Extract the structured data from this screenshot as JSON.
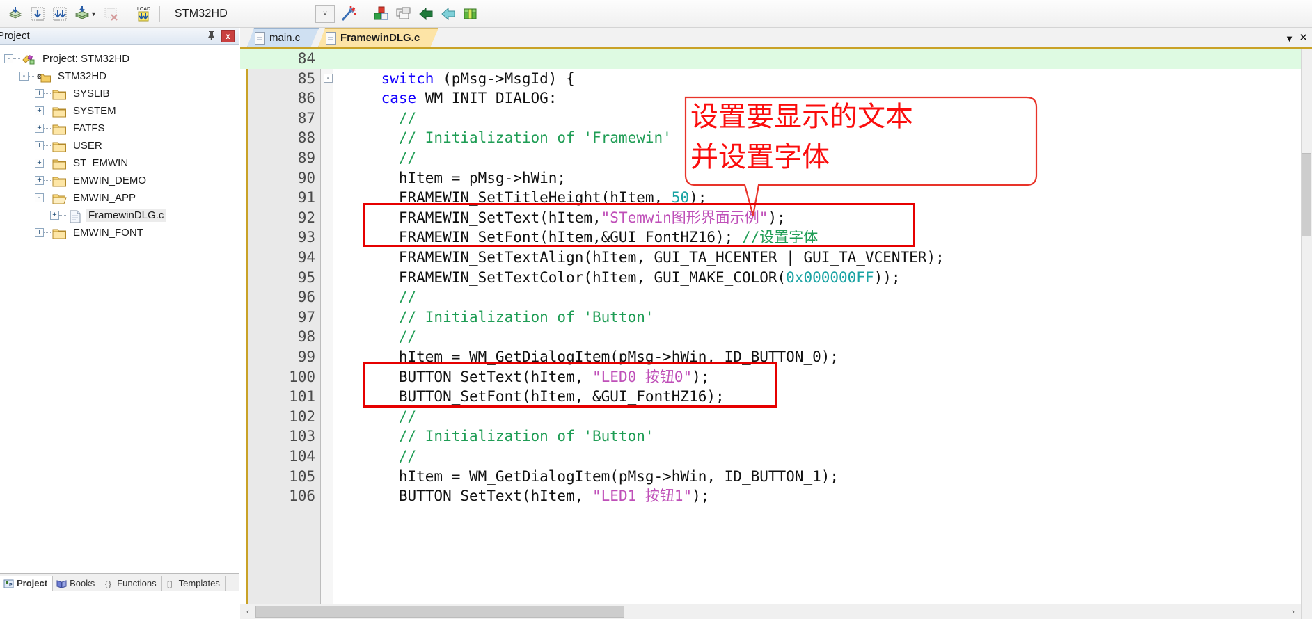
{
  "toolbar": {
    "icons": [
      {
        "name": "download-to-flash-icon"
      },
      {
        "name": "debug-start-icon"
      },
      {
        "name": "debug-stop-icon"
      },
      {
        "name": "batch-build-icon"
      },
      {
        "name": "remove-icon"
      },
      {
        "name": "load-icon"
      }
    ],
    "target_select": "STM32HD",
    "combo_caret": "∨",
    "right_icons": [
      {
        "name": "magic-wand-icon"
      },
      {
        "name": "target-options-icon"
      },
      {
        "name": "manage-windows-icon"
      },
      {
        "name": "bookmark-blue-icon"
      },
      {
        "name": "bookmark-green-icon"
      },
      {
        "name": "pack-installer-icon"
      }
    ]
  },
  "project_panel": {
    "title": "Project",
    "pin_glyph": "丨",
    "close_label": "x",
    "tree": [
      {
        "label": "Project: STM32HD",
        "depth": 0,
        "expander": "-",
        "icon": "project-icon"
      },
      {
        "label": "STM32HD",
        "depth": 1,
        "expander": "-",
        "icon": "target-icon"
      },
      {
        "label": "SYSLIB",
        "depth": 2,
        "expander": "+",
        "icon": "folder-closed-icon"
      },
      {
        "label": "SYSTEM",
        "depth": 2,
        "expander": "+",
        "icon": "folder-closed-icon"
      },
      {
        "label": "FATFS",
        "depth": 2,
        "expander": "+",
        "icon": "folder-closed-icon"
      },
      {
        "label": "USER",
        "depth": 2,
        "expander": "+",
        "icon": "folder-closed-icon"
      },
      {
        "label": "ST_EMWIN",
        "depth": 2,
        "expander": "+",
        "icon": "folder-closed-icon"
      },
      {
        "label": "EMWIN_DEMO",
        "depth": 2,
        "expander": "+",
        "icon": "folder-closed-icon"
      },
      {
        "label": "EMWIN_APP",
        "depth": 2,
        "expander": "-",
        "icon": "folder-open-icon"
      },
      {
        "label": "FramewinDLG.c",
        "depth": 3,
        "expander": "+",
        "icon": "c-file-icon",
        "selected": true
      },
      {
        "label": "EMWIN_FONT",
        "depth": 2,
        "expander": "+",
        "icon": "folder-closed-icon"
      }
    ],
    "bottom_tabs": [
      {
        "label": "Project",
        "icon": "project-tab-icon",
        "active": true
      },
      {
        "label": "Books",
        "icon": "books-tab-icon",
        "active": false
      },
      {
        "label": "Functions",
        "icon": "functions-tab-icon",
        "active": false
      },
      {
        "label": "Templates",
        "icon": "templates-tab-icon",
        "active": false
      }
    ]
  },
  "editor": {
    "tabs": [
      {
        "label": "main.c",
        "active": false
      },
      {
        "label": "FramewinDLG.c",
        "active": true
      }
    ],
    "tabbar_caret": "▼",
    "tabbar_close": "✕",
    "lines": [
      {
        "num": "84",
        "highlight": true,
        "fold": "",
        "tokens": []
      },
      {
        "num": "85",
        "highlight": false,
        "fold": "-",
        "tokens": [
          {
            "t": "    ",
            "c": ""
          },
          {
            "t": "switch",
            "c": "kw"
          },
          {
            "t": " (pMsg->MsgId) {",
            "c": ""
          }
        ]
      },
      {
        "num": "86",
        "highlight": false,
        "fold": "",
        "tokens": [
          {
            "t": "    ",
            "c": ""
          },
          {
            "t": "case",
            "c": "kw"
          },
          {
            "t": " WM_INIT_DIALOG:",
            "c": ""
          }
        ]
      },
      {
        "num": "87",
        "highlight": false,
        "fold": "",
        "tokens": [
          {
            "t": "      ",
            "c": ""
          },
          {
            "t": "//",
            "c": "cmt"
          }
        ]
      },
      {
        "num": "88",
        "highlight": false,
        "fold": "",
        "tokens": [
          {
            "t": "      ",
            "c": ""
          },
          {
            "t": "// Initialization of 'Framewin'",
            "c": "cmt"
          }
        ]
      },
      {
        "num": "89",
        "highlight": false,
        "fold": "",
        "tokens": [
          {
            "t": "      ",
            "c": ""
          },
          {
            "t": "//",
            "c": "cmt"
          }
        ]
      },
      {
        "num": "90",
        "highlight": false,
        "fold": "",
        "tokens": [
          {
            "t": "      hItem = pMsg->hWin;",
            "c": ""
          }
        ]
      },
      {
        "num": "91",
        "highlight": false,
        "fold": "",
        "tokens": [
          {
            "t": "      FRAMEWIN_SetTitleHeight(hItem, ",
            "c": ""
          },
          {
            "t": "50",
            "c": "num2"
          },
          {
            "t": ");",
            "c": ""
          }
        ]
      },
      {
        "num": "92",
        "highlight": false,
        "fold": "",
        "tokens": [
          {
            "t": "      FRAMEWIN_SetText(hItem,",
            "c": ""
          },
          {
            "t": "\"STemwin图形界面示例\"",
            "c": "str"
          },
          {
            "t": ");",
            "c": ""
          }
        ]
      },
      {
        "num": "93",
        "highlight": false,
        "fold": "",
        "tokens": [
          {
            "t": "      FRAMEWIN_SetFont(hItem,&GUI_FontHZ16); ",
            "c": ""
          },
          {
            "t": "//设置字体",
            "c": "cmt"
          }
        ]
      },
      {
        "num": "94",
        "highlight": false,
        "fold": "",
        "tokens": [
          {
            "t": "      FRAMEWIN_SetTextAlign(hItem, GUI_TA_HCENTER | GUI_TA_VCENTER);",
            "c": ""
          }
        ]
      },
      {
        "num": "95",
        "highlight": false,
        "fold": "",
        "tokens": [
          {
            "t": "      FRAMEWIN_SetTextColor(hItem, GUI_MAKE_COLOR(",
            "c": ""
          },
          {
            "t": "0x000000FF",
            "c": "num2"
          },
          {
            "t": "));",
            "c": ""
          }
        ]
      },
      {
        "num": "96",
        "highlight": false,
        "fold": "",
        "tokens": [
          {
            "t": "      ",
            "c": ""
          },
          {
            "t": "//",
            "c": "cmt"
          }
        ]
      },
      {
        "num": "97",
        "highlight": false,
        "fold": "",
        "tokens": [
          {
            "t": "      ",
            "c": ""
          },
          {
            "t": "// Initialization of 'Button'",
            "c": "cmt"
          }
        ]
      },
      {
        "num": "98",
        "highlight": false,
        "fold": "",
        "tokens": [
          {
            "t": "      ",
            "c": ""
          },
          {
            "t": "//",
            "c": "cmt"
          }
        ]
      },
      {
        "num": "99",
        "highlight": false,
        "fold": "",
        "tokens": [
          {
            "t": "      hItem = WM_GetDialogItem(pMsg->hWin, ID_BUTTON_0);",
            "c": ""
          }
        ]
      },
      {
        "num": "100",
        "highlight": false,
        "fold": "",
        "tokens": [
          {
            "t": "      BUTTON_SetText(hItem, ",
            "c": ""
          },
          {
            "t": "\"LED0_按钮0\"",
            "c": "str"
          },
          {
            "t": ");",
            "c": ""
          }
        ]
      },
      {
        "num": "101",
        "highlight": false,
        "fold": "",
        "tokens": [
          {
            "t": "      BUTTON_SetFont(hItem, &GUI_FontHZ16);",
            "c": ""
          }
        ]
      },
      {
        "num": "102",
        "highlight": false,
        "fold": "",
        "tokens": [
          {
            "t": "      ",
            "c": ""
          },
          {
            "t": "//",
            "c": "cmt"
          }
        ]
      },
      {
        "num": "103",
        "highlight": false,
        "fold": "",
        "tokens": [
          {
            "t": "      ",
            "c": ""
          },
          {
            "t": "// Initialization of 'Button'",
            "c": "cmt"
          }
        ]
      },
      {
        "num": "104",
        "highlight": false,
        "fold": "",
        "tokens": [
          {
            "t": "      ",
            "c": ""
          },
          {
            "t": "//",
            "c": "cmt"
          }
        ]
      },
      {
        "num": "105",
        "highlight": false,
        "fold": "",
        "tokens": [
          {
            "t": "      hItem = WM_GetDialogItem(pMsg->hWin, ID_BUTTON_1);",
            "c": ""
          }
        ]
      },
      {
        "num": "106",
        "highlight": false,
        "fold": "",
        "tokens": [
          {
            "t": "      BUTTON_SetText(hItem, ",
            "c": ""
          },
          {
            "t": "\"LED1_按钮1\"",
            "c": "str"
          },
          {
            "t": ");",
            "c": ""
          }
        ]
      }
    ]
  },
  "annotations": {
    "callout_line1": "设置要显示的文本",
    "callout_line2": "并设置字体",
    "color": "#fb0d0d",
    "box_color": "#e60000",
    "boxes": [
      {
        "name": "framewin-settext-setfont-box"
      },
      {
        "name": "button-settext-setfont-box"
      }
    ]
  },
  "scrollbars": {
    "left_arrow": "‹",
    "right_arrow": "›",
    "up_arrow": "⌃",
    "down_arrow": "⌄"
  }
}
